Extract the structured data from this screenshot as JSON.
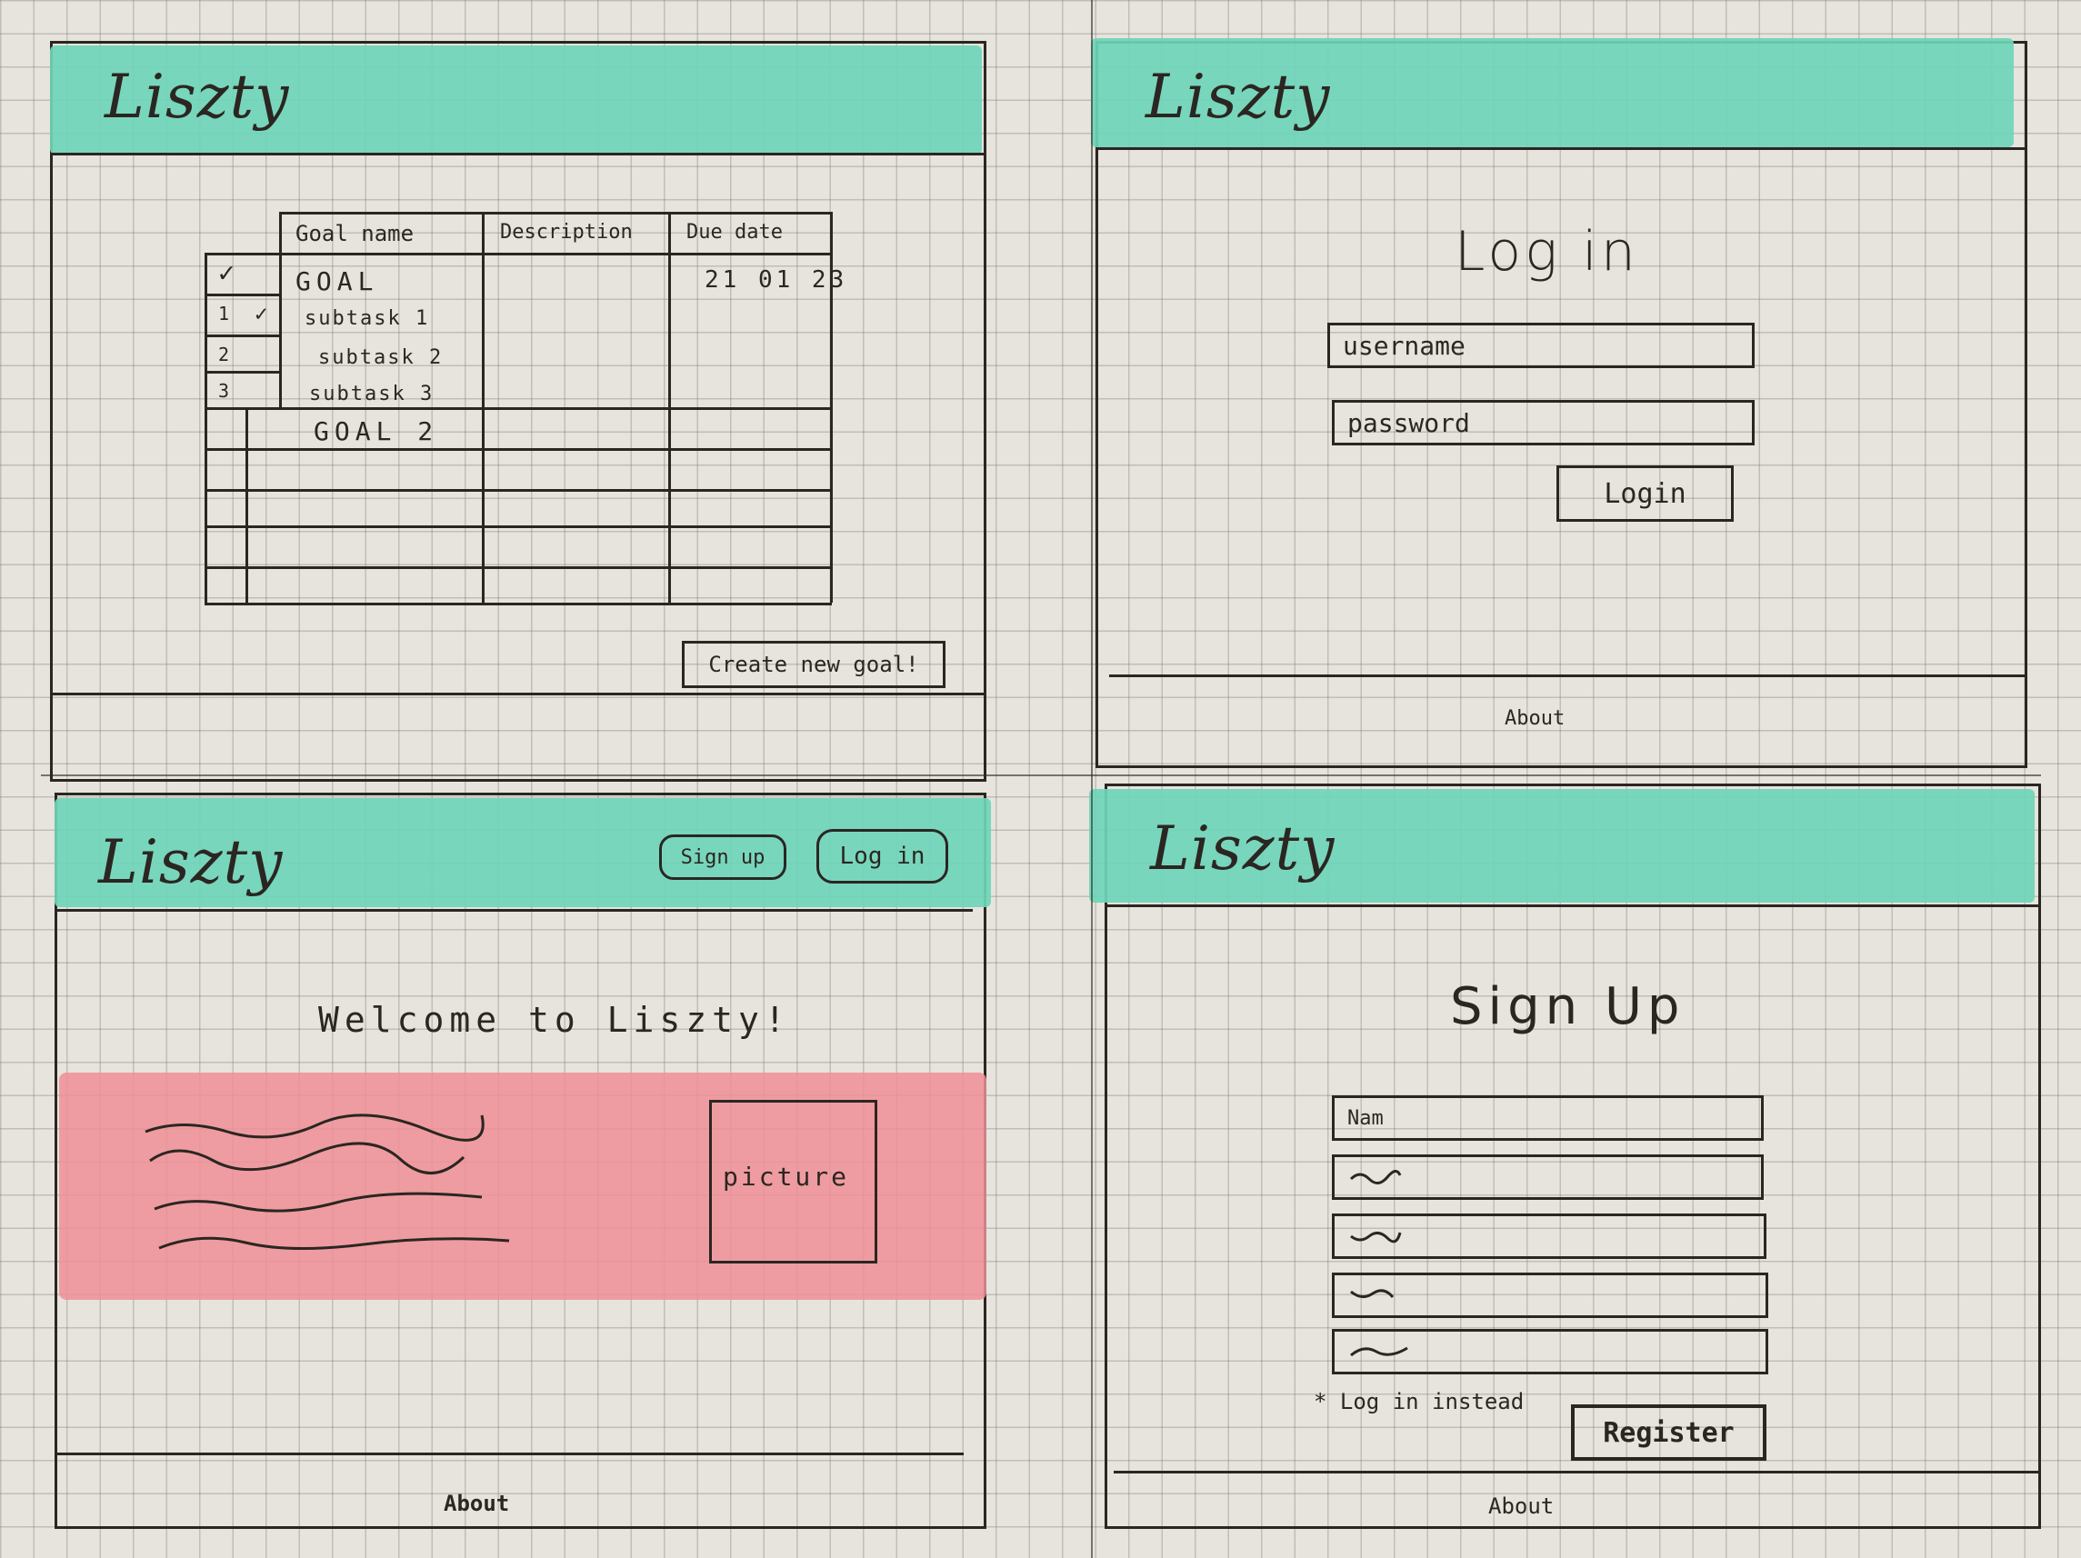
{
  "brand": "Liszty",
  "goals_screen": {
    "columns": [
      "Goal name",
      "Description",
      "Due date"
    ],
    "rows": [
      {
        "check": "✓",
        "num": "",
        "name": "GOAL",
        "date": "21 01 23"
      },
      {
        "check": "✓",
        "num": "1",
        "name": "subtask 1",
        "date": ""
      },
      {
        "check": "",
        "num": "2",
        "name": "subtask 2",
        "date": ""
      },
      {
        "check": "",
        "num": "3",
        "name": "subtask 3",
        "date": ""
      },
      {
        "check": "",
        "num": "",
        "name": "GOAL 2",
        "date": ""
      }
    ],
    "create_button": "Create new goal!"
  },
  "login_screen": {
    "title": "Log in",
    "username_placeholder": "username",
    "password_placeholder": "password",
    "login_button": "Login",
    "footer": "About"
  },
  "home_screen": {
    "signup_button": "Sign up",
    "login_button": "Log in",
    "welcome": "Welcome to Liszty!",
    "picture_label": "picture",
    "footer": "About"
  },
  "signup_screen": {
    "title": "Sign Up",
    "name_placeholder": "Nam",
    "login_instead": "* Log in instead",
    "register_button": "Register",
    "footer": "About"
  },
  "colors": {
    "header": "#6fd5b8",
    "highlight": "#ee8f96",
    "ink": "#2b2622"
  }
}
